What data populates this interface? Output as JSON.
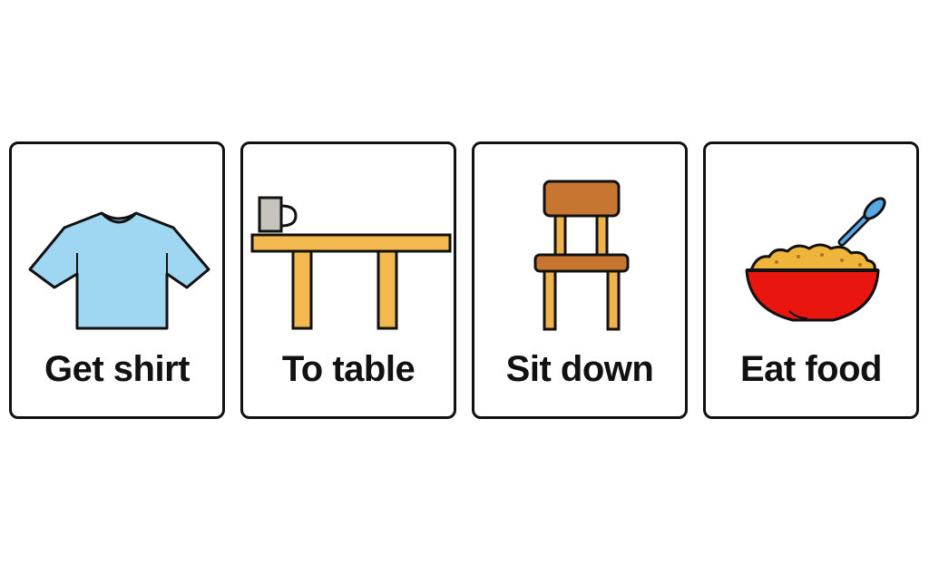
{
  "cards": [
    {
      "label": "Get shirt",
      "icon": "shirt-icon"
    },
    {
      "label": "To table",
      "icon": "table-icon"
    },
    {
      "label": "Sit down",
      "icon": "chair-icon"
    },
    {
      "label": "Eat food",
      "icon": "bowl-icon"
    }
  ],
  "colors": {
    "outline": "#111111",
    "shirt": "#9fd6f2",
    "table": "#f3b94f",
    "mug": "#c7c3bd",
    "chair_seat": "#c77632",
    "chair_legs": "#f0b24a",
    "bowl": "#e8160f",
    "food": "#efb53a",
    "spoon": "#5aa7e6"
  }
}
